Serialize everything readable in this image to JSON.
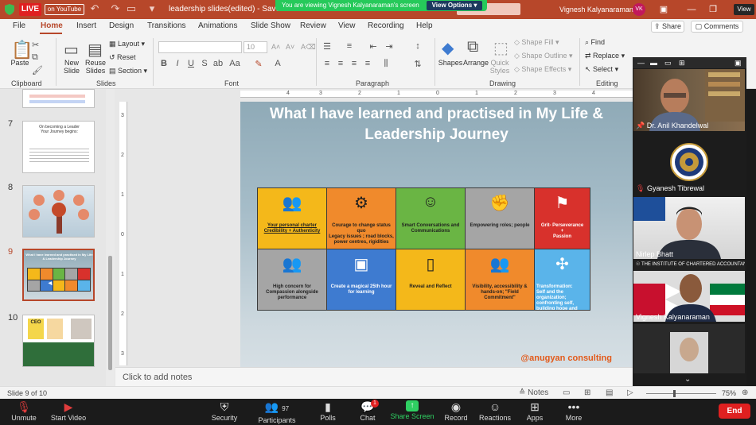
{
  "titlebar": {
    "live": "LIVE",
    "youtube": "on YouTube",
    "doc_title": "leadership slides(edited)  -  Saved to this PC",
    "viewing_banner": "You are viewing Vignesh Kalyanaraman's screen",
    "view_options": "View Options",
    "user_name": "Vignesh Kalyanaraman",
    "user_initials": "VK",
    "view_label": "View"
  },
  "menu": {
    "tabs": [
      "File",
      "Home",
      "Insert",
      "Design",
      "Transitions",
      "Animations",
      "Slide Show",
      "Review",
      "View",
      "Recording",
      "Help"
    ],
    "share": "Share",
    "comments": "Comments"
  },
  "ribbon": {
    "clipboard": {
      "paste": "Paste",
      "group": "Clipboard"
    },
    "slides": {
      "new_slide": "New Slide",
      "reuse_slides": "Reuse Slides",
      "layout": "Layout",
      "reset": "Reset",
      "section": "Section",
      "group": "Slides"
    },
    "font": {
      "size": "10",
      "group": "Font"
    },
    "paragraph": {
      "group": "Paragraph"
    },
    "drawing": {
      "shapes": "Shapes",
      "arrange": "Arrange",
      "quick_styles": "Quick Styles",
      "shape_fill": "Shape Fill",
      "shape_outline": "Shape Outline",
      "shape_effects": "Shape Effects",
      "group": "Drawing"
    },
    "editing": {
      "find": "Find",
      "replace": "Replace",
      "select": "Select",
      "group": "Editing"
    }
  },
  "thumbnails": [
    {
      "number": "7",
      "title": "On becoming a Leader\nYour Journey begins:"
    },
    {
      "number": "8",
      "title": ""
    },
    {
      "number": "9",
      "title": "What I have learned and practised in My Life & Leadership Journey"
    },
    {
      "number": "10",
      "title": "CEO"
    }
  ],
  "slide": {
    "title": "What I have learned and practised in My Life & Leadership Journey",
    "credit": "@anugyan consulting",
    "cells": [
      {
        "text": "Your personal charter\nCredibility + Authenticity",
        "color": "#f4b81a",
        "icon": "people-icon"
      },
      {
        "text": "Courage to change status quo\nLegacy issues ; road blocks, power centres, rigidities",
        "color": "#f08a2c",
        "icon": "gear-globe-icon"
      },
      {
        "text": "Smart Conversations and Communications",
        "color": "#6ab544",
        "icon": "conversation-icon"
      },
      {
        "text": "Empowering roles; people",
        "color": "#a5a5a5",
        "icon": "fist-icon"
      },
      {
        "text": "Grit- Perseverance\n+\nPassion",
        "color": "#d8312c",
        "icon": "flag-icon"
      },
      {
        "text": "High concern for Compassion alongside performance",
        "color": "#a5a5a5",
        "icon": "team-icon"
      },
      {
        "text": "Create a magical 25th hour for learning",
        "color": "#3e7bd0",
        "icon": "book-icon"
      },
      {
        "text": "Reveal and Reflect",
        "color": "#f4b81a",
        "icon": "mirror-icon"
      },
      {
        "text": "Visibility, accessibility & hands-on; \"Field Commitment\"",
        "color": "#f08a2c",
        "icon": "crowd-icon"
      },
      {
        "text": "Transformation:\nSelf and the organization; confronting self, building hope and positivity.",
        "color": "#5ab4ea",
        "icon": "puzzle-icon"
      }
    ]
  },
  "notes": {
    "placeholder": "Click to add notes"
  },
  "statusbar": {
    "slide_count": "Slide 9 of 10",
    "notes": "Notes",
    "zoom": "75%"
  },
  "participants": [
    {
      "name": "Dr. Anil Khandelwal",
      "muted": false
    },
    {
      "name": "Gyanesh Tibrewal",
      "muted": true
    },
    {
      "name": "Nirlep Bhatt",
      "muted": false
    },
    {
      "name": "Vignesh Kalyanaraman",
      "muted": false
    },
    {
      "name": "",
      "muted": false
    }
  ],
  "zoombar": {
    "unmute": "Unmute",
    "start_video": "Start Video",
    "security": "Security",
    "participants_count": "97",
    "participants": "Participants",
    "polls": "Polls",
    "chat": "Chat",
    "chat_badge": "1",
    "share_screen": "Share Screen",
    "record": "Record",
    "reactions": "Reactions",
    "apps": "Apps",
    "more": "More",
    "end": "End"
  }
}
